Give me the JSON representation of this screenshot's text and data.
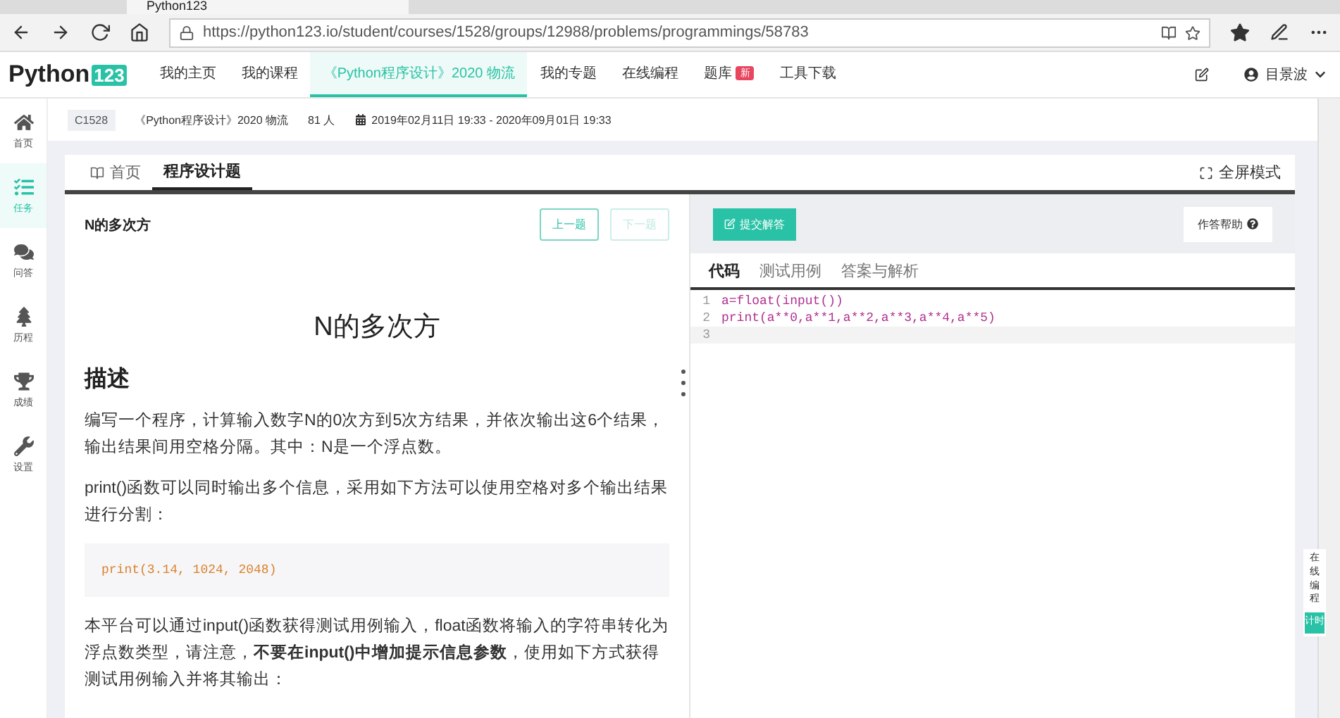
{
  "browser": {
    "tab_title": "Python123",
    "url": "https://python123.io/student/courses/1528/groups/12988/problems/programmings/58783"
  },
  "nav": {
    "logo_text": "Python",
    "logo_badge": "123",
    "items": [
      {
        "label": "我的主页",
        "selected": false
      },
      {
        "label": "我的课程",
        "selected": false
      },
      {
        "label": "《Python程序设计》2020 物流",
        "selected": true
      },
      {
        "label": "我的专题",
        "selected": false
      },
      {
        "label": "在线编程",
        "selected": false
      },
      {
        "label": "题库",
        "selected": false,
        "badge": "新"
      },
      {
        "label": "工具下载",
        "selected": false
      }
    ],
    "user": "目景波"
  },
  "sidebar": {
    "items": [
      {
        "label": "首页",
        "selected": false
      },
      {
        "label": "任务",
        "selected": true
      },
      {
        "label": "问答",
        "selected": false
      },
      {
        "label": "历程",
        "selected": false
      },
      {
        "label": "成绩",
        "selected": false
      },
      {
        "label": "设置",
        "selected": false
      }
    ]
  },
  "course_bar": {
    "code": "C1528",
    "name": "《Python程序设计》2020 物流",
    "students": "81 人",
    "period": "2019年02月11日 19:33 - 2020年09月01日 19:33"
  },
  "tabs": [
    {
      "label": "首页",
      "selected": false
    },
    {
      "label": "程序设计题",
      "selected": true
    }
  ],
  "fullscreen": "全屏模式",
  "problem": {
    "name": "N的多次方",
    "prev": {
      "label": "上一题",
      "disabled": false
    },
    "next": {
      "label": "下一题",
      "disabled": true
    },
    "title": "N的多次方",
    "section": "描述",
    "paragraphs": [
      "编写一个程序，计算输入数字N的0次方到5次方结果，并依次输出这6个结果，输出结果间用空格分隔。其中：N是一个浮点数。",
      "print()函数可以同时输出多个信息，采用如下方法可以使用空格对多个输出结果进行分割："
    ],
    "code_sample": "print(3.14, 1024, 2048)",
    "paragraph_after": "本平台可以通过input()函数获得测试用例输入，float函数将输入的字符串转化为浮点数类型，请注意，**不要在input()中增加提示信息参数**，使用如下方式获得测试用例输入并将其输出："
  },
  "editor": {
    "submit": "提交解答",
    "help": "作答帮助",
    "tabs": [
      {
        "label": "代码",
        "selected": true
      },
      {
        "label": "测试用例",
        "selected": false
      },
      {
        "label": "答案与解析",
        "selected": false
      }
    ],
    "lines": [
      {
        "number": "1",
        "text": "a=float(input())"
      },
      {
        "number": "2",
        "text": "print(a**0,a**1,a**2,a**3,a**4,a**5)"
      },
      {
        "number": "3"
      }
    ]
  },
  "float_panel": {
    "label": "在线编程",
    "button": "计时"
  }
}
